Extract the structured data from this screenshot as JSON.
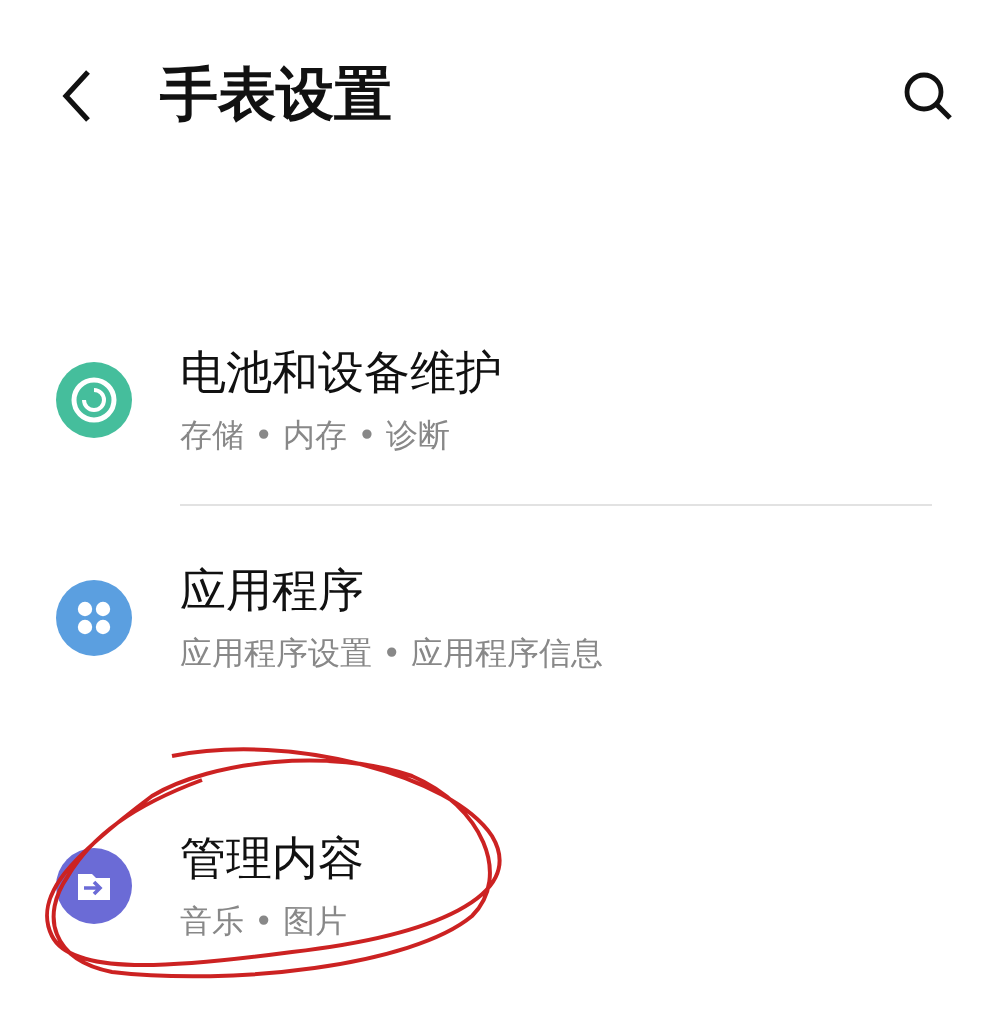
{
  "header": {
    "title": "手表设置"
  },
  "items": [
    {
      "title": "电池和设备维护",
      "subtitle": "存储 • 内存 • 诊断",
      "color": "#45be9c",
      "kind": "care",
      "divider_below": true
    },
    {
      "title": "应用程序",
      "subtitle": "应用程序设置 • 应用程序信息",
      "color": "#5b9fe0",
      "kind": "apps",
      "divider_below": false
    },
    {
      "title": "管理内容",
      "subtitle": "音乐 • 图片",
      "color": "#6b6bd6",
      "kind": "content",
      "divider_below": false
    }
  ]
}
